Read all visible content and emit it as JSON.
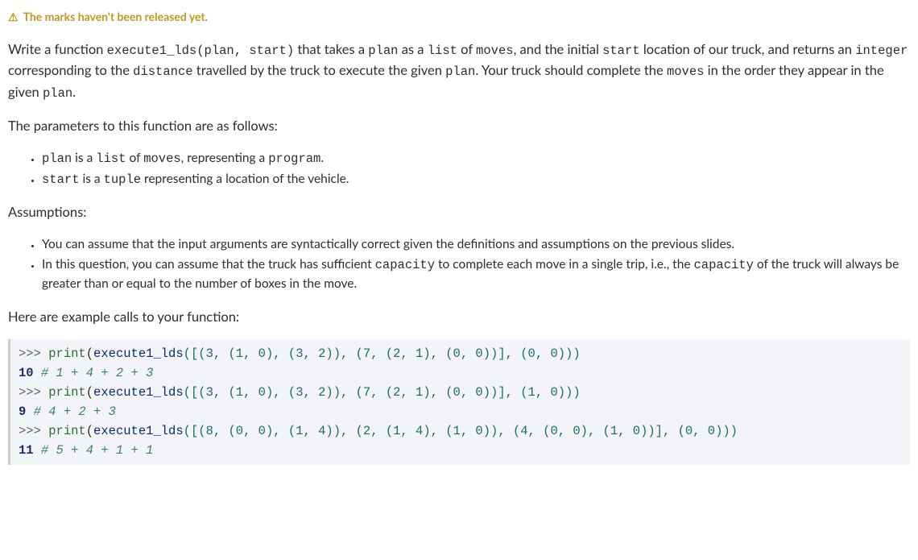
{
  "warning": {
    "icon": "⚠",
    "text": "The marks haven't been released yet."
  },
  "p1": {
    "t1": "Write a function ",
    "c1": "execute1_lds(plan, start)",
    "t2": " that takes a ",
    "c2": "plan",
    "t3": " as a ",
    "c3": "list",
    "t4": " of ",
    "c4": "moves",
    "t5": ", and the initial ",
    "c5": "start",
    "t6": " location of our truck, and returns an ",
    "c6": "integer",
    "t7": " corresponding to the ",
    "c7": "distance",
    "t8": " travelled by the truck to execute the given ",
    "c8": "plan",
    "t9": ". Your truck should complete the ",
    "c9": "moves",
    "t10": " in the order they appear in the given ",
    "c10": "plan",
    "t11": "."
  },
  "p2": "The parameters to this function are as follows:",
  "params": {
    "li1": {
      "c1": "plan",
      "t1": " is a ",
      "c2": "list",
      "t2": " of ",
      "c3": "moves",
      "t3": ", representing a ",
      "c4": "program",
      "t4": "."
    },
    "li2": {
      "c1": "start",
      "t1": " is a ",
      "c2": "tuple",
      "t2": " representing a location of the vehicle."
    }
  },
  "p3": "Assumptions:",
  "assumptions": {
    "li1": "You can assume that the input arguments are syntactically correct given the definitions and assumptions on the previous slides.",
    "li2": {
      "t1": "In this question, you can assume that the truck has sufficient ",
      "c1": "capacity",
      "t2": " to complete each move in a single trip, i.e., the ",
      "c2": "capacity",
      "t3": " of the truck will always be greater than or equal to the number of boxes in the move."
    }
  },
  "p4": "Here are example calls to your function:",
  "code": {
    "prompt": ">>> ",
    "print": "print",
    "func": "execute1_lds",
    "l1_args": "([(3, (1, 0), (3, 2)), (7, (2, 1), (0, 0))], (0, 0)))",
    "l1_out": "10 ",
    "l1_comment": "# 1 + 4 + 2 + 3",
    "l2_args": "([(3, (1, 0), (3, 2)), (7, (2, 1), (0, 0))], (1, 0)))",
    "l2_out": "9 ",
    "l2_comment": "# 4 + 2 + 3",
    "l3_args": "([(8, (0, 0), (1, 4)), (2, (1, 4), (1, 0)), (4, (0, 0), (1, 0))], (0, 0)))",
    "l3_out": "11 ",
    "l3_comment": "# 5 + 4 + 1 + 1"
  }
}
